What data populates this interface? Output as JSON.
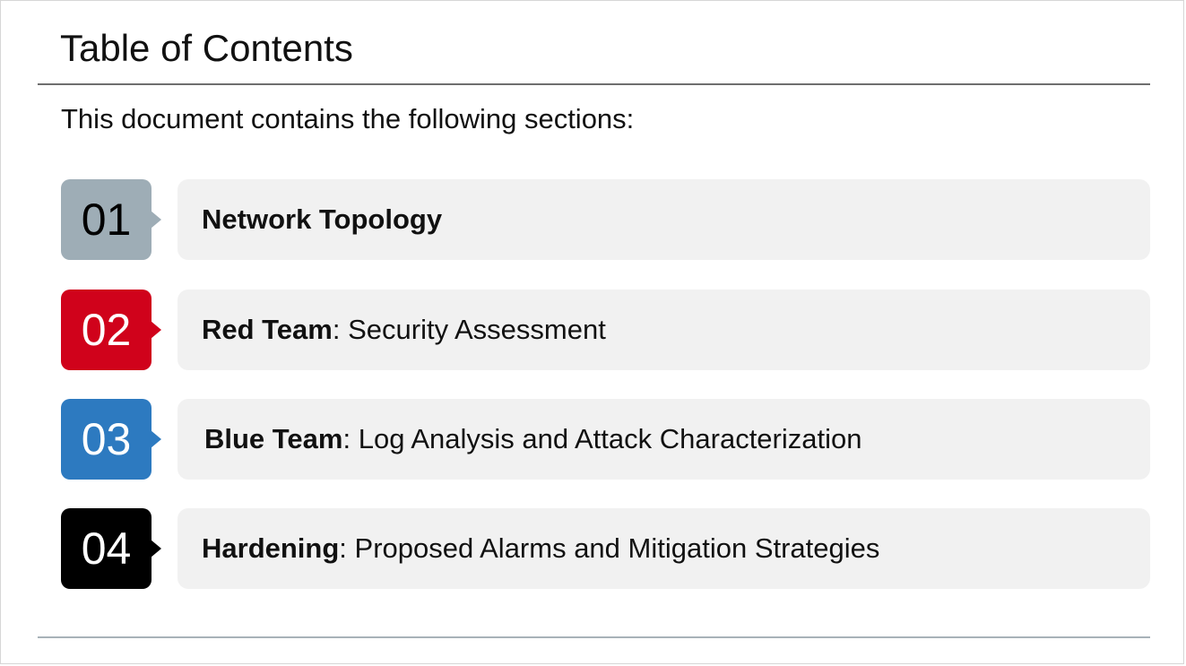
{
  "page": {
    "title": "Table of Contents",
    "intro": "This document contains the following sections:"
  },
  "sections": [
    {
      "number": "01",
      "title_bold": "Network Topology",
      "subtitle": "",
      "color": "#9eadb6",
      "number_text_color": "#000000"
    },
    {
      "number": "02",
      "title_bold": "Red Team",
      "subtitle": ": Security Assessment",
      "color": "#d0021b",
      "number_text_color": "#ffffff"
    },
    {
      "number": "03",
      "title_bold": "Blue Team",
      "subtitle": ": Log Analysis and Attack Characterization",
      "color": "#2d7ac0",
      "number_text_color": "#ffffff"
    },
    {
      "number": "04",
      "title_bold": "Hardening",
      "subtitle": ": Proposed Alarms and Mitigation Strategies",
      "color": "#000000",
      "number_text_color": "#ffffff"
    }
  ]
}
